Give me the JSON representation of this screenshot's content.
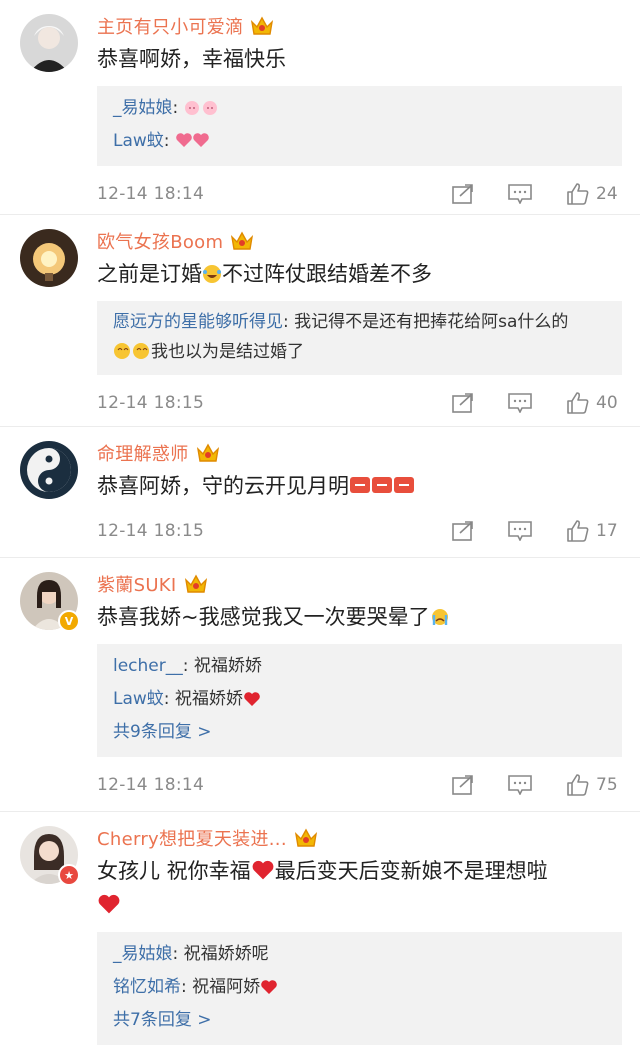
{
  "comments": [
    {
      "username": "主页有只小可爱滴",
      "text": "恭喜啊娇，幸福快乐",
      "replies": [
        {
          "name": "_易姑娘",
          "text": ": "
        },
        {
          "name": "Law蚊",
          "text": ": "
        }
      ],
      "time": "12-14 18:14",
      "likes": "24"
    },
    {
      "username": "欧气女孩Boom",
      "text_a": "之前是订婚",
      "text_b": "不过阵仗跟结婚差不多",
      "reply_name": "愿远方的星能够听得见",
      "reply_a": ": 我记得不是还有把捧花给阿sa什么的",
      "reply_b": "我也以为是结过婚了",
      "time": "12-14 18:15",
      "likes": "40"
    },
    {
      "username": "命理解惑师",
      "text": "恭喜阿娇，守的云开见月明",
      "time": "12-14 18:15",
      "likes": "17"
    },
    {
      "username": "紫蘭SUKI",
      "text": "恭喜我娇~我感觉我又一次要哭晕了",
      "replies": [
        {
          "name": "lecher__",
          "text": ": 祝福娇娇"
        },
        {
          "name": "Law蚊",
          "text": ": 祝福娇娇"
        }
      ],
      "more": "共9条回复 >",
      "time": "12-14 18:14",
      "likes": "75"
    },
    {
      "username": "Cherry想把夏天装进...",
      "text": "女孩儿 祝你幸福",
      "text_b": "最后变天后变新娘不是理想啦",
      "replies": [
        {
          "name": "_易姑娘",
          "text": ": 祝福娇娇呢"
        },
        {
          "name": "铭忆如希",
          "text": ": 祝福阿娇"
        }
      ],
      "more": "共7条回复 >"
    }
  ],
  "icons": {
    "repost": "share-icon",
    "comment": "comment-icon",
    "like": "thumbs-up-icon",
    "crown": "vip-crown-icon"
  },
  "colors": {
    "username": "#eb7350",
    "reply_name": "#3e6fa8",
    "meta": "#8a8a8a",
    "reply_bg": "#f2f2f2"
  }
}
